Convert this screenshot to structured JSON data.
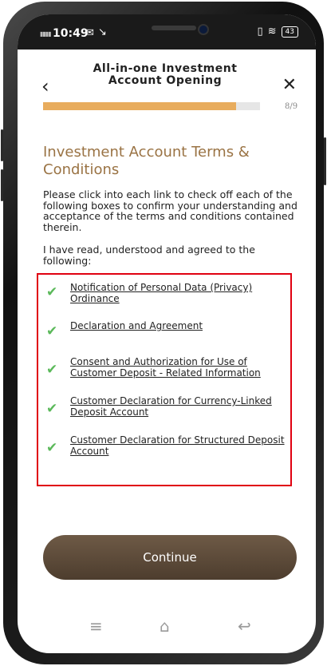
{
  "status": {
    "time": "10:49",
    "battery": "43"
  },
  "header": {
    "title": "All-in-one Investment Account Opening"
  },
  "progress": {
    "fraction": 0.89,
    "label": "8/9"
  },
  "heading": "Investment Account Terms & Conditions",
  "intro": "Please click into each link to check off each of the following boxes to confirm your understanding and acceptance of the terms and conditions contained therein.",
  "read_text": "I have read, understood and agreed to the following:",
  "items": [
    "Notification of Personal Data (Privacy) Ordinance",
    "Declaration and Agreement",
    "Consent and Authorization for Use of Customer Deposit - Related Information",
    "Customer Declaration for Currency-Linked Deposit Account",
    "Customer Declaration for Structured Deposit Account"
  ],
  "continue_label": "Continue",
  "colors": {
    "accent": "#9a7344",
    "progress": "#e8ac5d",
    "check": "#5bb95a",
    "highlight": "#e00010",
    "button": "#5c4a39"
  }
}
